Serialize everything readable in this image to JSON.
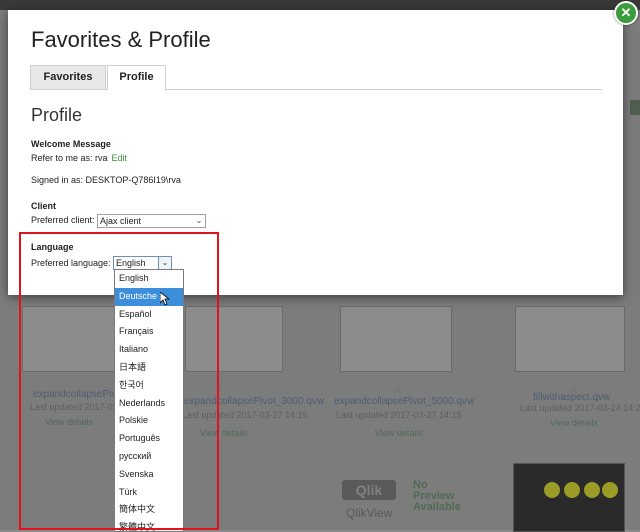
{
  "modal": {
    "title": "Favorites & Profile",
    "close_icon": "close-icon",
    "tabs": [
      {
        "label": "Favorites",
        "active": false
      },
      {
        "label": "Profile",
        "active": true
      }
    ],
    "section_title": "Profile",
    "welcome": {
      "heading": "Welcome Message",
      "refer_text": "Refer to me as: rva",
      "edit_label": "Edit",
      "signed_in": "Signed in as: DESKTOP-Q786I19\\rva"
    },
    "client": {
      "heading": "Client",
      "label": "Preferred client:",
      "value": "Ajax client"
    },
    "language": {
      "heading": "Language",
      "label": "Preferred language:",
      "value": "English",
      "options": [
        "English",
        "Deutsche",
        "Español",
        "Français",
        "Italiano",
        "日本語",
        "한국어",
        "Nederlands",
        "Polskie",
        "Português",
        "русский",
        "Svenska",
        "Türk",
        "簡体中文",
        "繁體中文"
      ],
      "highlighted_index": 1
    }
  },
  "background": {
    "docs": [
      {
        "title": "expandcollapsePivot.qvw",
        "updated": "Last updated 2017-03-27 14:15",
        "link": "View details"
      },
      {
        "title": "expandcollapsePivot_3000.qvw",
        "updated": "Last updated 2017-03-27 14:15",
        "link": "View details"
      },
      {
        "title": "expandcollapsePivot_5000.qvw",
        "updated": "Last updated 2017-03-27 14:15",
        "link": "View details"
      },
      {
        "title": "fillwithaspect.qvw",
        "updated": "Last updated 2017-03-24 14:25",
        "link": "View details"
      }
    ],
    "qlik_logo": "Qlik",
    "qlikview": "QlikView",
    "no_preview": "No Preview Available"
  },
  "colors": {
    "accent": "#3b9c3b",
    "selection": "#3d8fdb",
    "annotation": "#e0121c"
  }
}
